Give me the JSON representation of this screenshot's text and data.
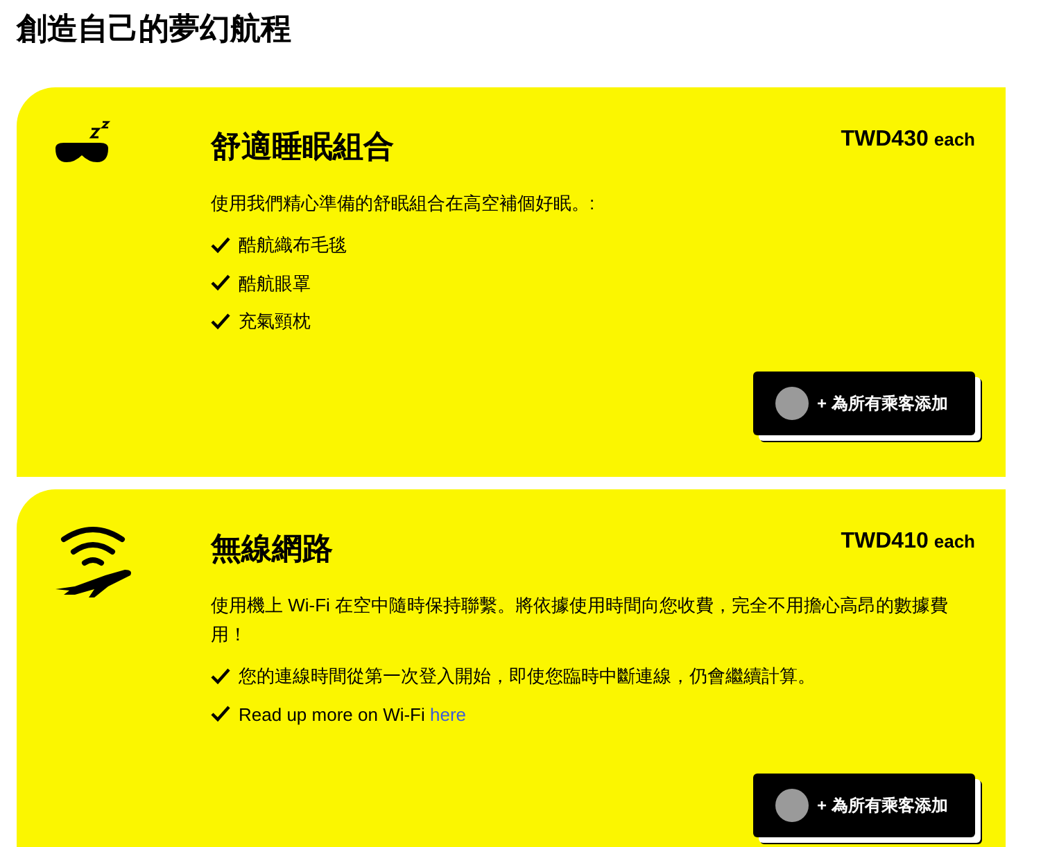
{
  "heading": "創造自己的夢幻航程",
  "cards": [
    {
      "kind": "sleep",
      "title": "舒適睡眠組合",
      "price": "TWD430",
      "price_unit": "each",
      "description": "使用我們精心準備的舒眠組合在高空補個好眠。:",
      "items": [
        {
          "text": "酷航織布毛毯"
        },
        {
          "text": "酷航眼罩"
        },
        {
          "text": "充氣頸枕"
        }
      ],
      "button": "+ 為所有乘客添加"
    },
    {
      "kind": "wifi",
      "title": "無線網路",
      "price": "TWD410",
      "price_unit": "each",
      "description": "使用機上 Wi-Fi 在空中隨時保持聯繫。將依據使用時間向您收費，完全不用擔心高昂的數據費用！",
      "items": [
        {
          "text": "您的連線時間從第一次登入開始，即使您臨時中斷連線，仍會繼續計算。"
        },
        {
          "text": "Read up more on Wi-Fi ",
          "link": "here"
        }
      ],
      "button": "+ 為所有乘客添加"
    }
  ]
}
